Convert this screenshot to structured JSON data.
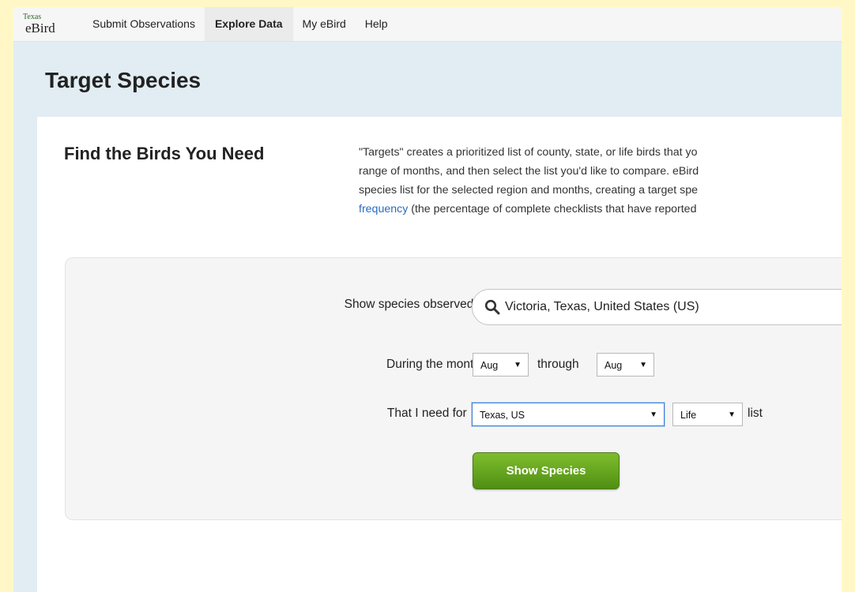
{
  "colors": {
    "outer_background": "#fff8c6",
    "header_band": "#e2edf3",
    "link": "#2a6bc1",
    "button": "#5c9e1a"
  },
  "brand": {
    "logo_small": "Texas",
    "logo_big": "eBird"
  },
  "nav": {
    "items": [
      {
        "label": "Submit Observations",
        "active": false
      },
      {
        "label": "Explore Data",
        "active": true
      },
      {
        "label": "My eBird",
        "active": false
      },
      {
        "label": "Help",
        "active": false
      }
    ]
  },
  "page": {
    "title": "Target Species"
  },
  "section": {
    "heading": "Find the Birds You Need",
    "intro_text": "\"Targets\" creates a prioritized list of county, state, or life birds that yo\nrange of months, and then select the list you'd like to compare. eBird\nspecies list for the selected region and months, creating a target spe\n",
    "intro_link": "frequency",
    "intro_tail": " (the percentage of complete checklists that have reported"
  },
  "form": {
    "region_label": "Show species observed in:",
    "region_icon": "search-icon",
    "region_value": "Victoria, Texas, United States (US)",
    "months_label": "During the months:",
    "month_from": "Aug",
    "through_label": "through",
    "month_to": "Aug",
    "need_label": "That I need for my:",
    "list_region": "Texas, US",
    "list_type": "Life",
    "list_suffix": "list",
    "submit_label": "Show Species"
  }
}
